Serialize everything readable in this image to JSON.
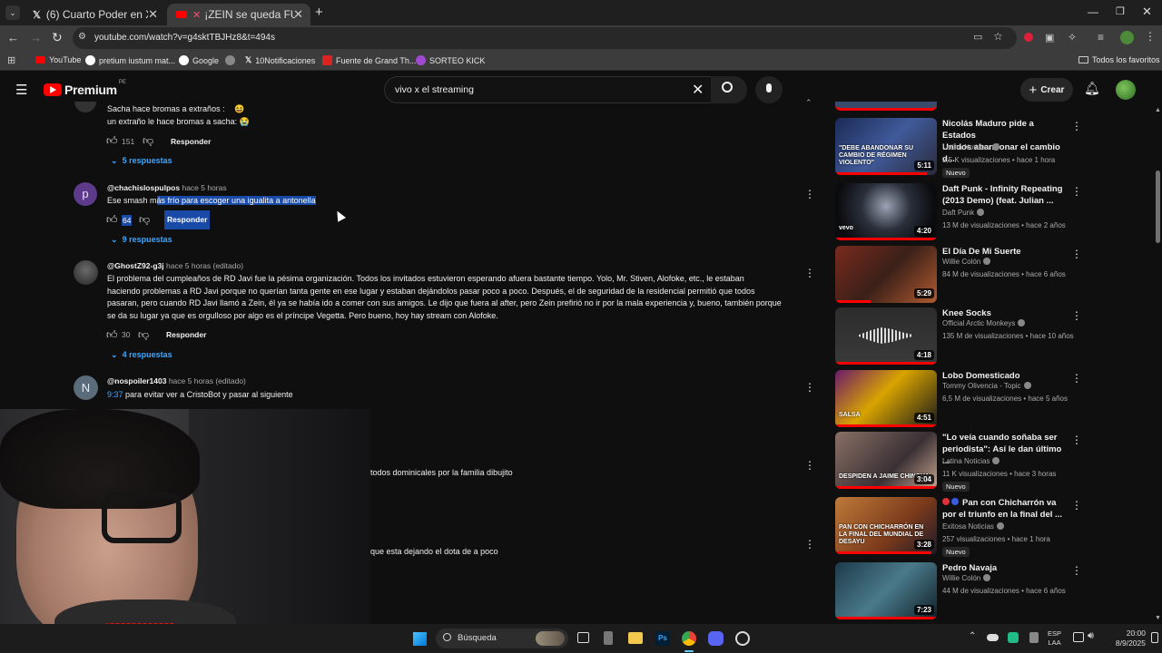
{
  "browser": {
    "tabs": [
      {
        "title": "(6) Cuarto Poder en X: \"#Cuarto"
      },
      {
        "title": "¡ZEIN se queda FUERA de FI"
      }
    ],
    "url": "youtube.com/watch?v=g4sktTBJHz8&t=494s",
    "bookmarks": [
      "YouTube",
      "pretium iustum mat...",
      "Google",
      "10Notificaciones",
      "Fuente de Grand Th...",
      "SORTEO KICK"
    ],
    "all_favorites": "Todos los favoritos"
  },
  "youtube": {
    "logo": "Premium",
    "region": "PE",
    "search_value": "vivo x el streaming",
    "create_label": "Crear"
  },
  "comments": [
    {
      "text_line1": "Sacha hace bromas a extraños :",
      "text_line2": "un extraño le hace bromas a sacha:",
      "likes": "151",
      "respond": "Responder",
      "replies": "5 respuestas"
    },
    {
      "avatar": "p",
      "author": "@chachislospulpos",
      "time": "hace 5 horas",
      "text_pre": "Ese smash m",
      "text_hl": "ás frío para escoger una igualita a antonella",
      "likes": "64",
      "respond": "Responder",
      "replies": "9 respuestas"
    },
    {
      "author": "@GhostZ92-g3j",
      "time": "hace 5 horas (editado)",
      "lines": [
        "El problema del cumpleaños de RD Javi fue la pésima organización. Todos los invitados estuvieron esperando afuera bastante tiempo. Yolo, Mr. Stiven, Alofoke, etc., le estaban",
        "haciendo problemas a RD Javi porque no querían tanta gente en ese lugar y estaban dejándolos pasar poco a poco. Después, el de seguridad de la residencial permitió que todos",
        "pasaran, pero cuando RD Javi llamó a Zein, él ya se había ido a comer con sus amigos. Le dijo que fuera al after, pero Zein prefirió no ir por la mala experiencia y, bueno, también porque",
        "se da su lugar ya que es orgulloso por algo es el príncipe Vegetta. Pero bueno, hoy hay stream con Alofoke."
      ],
      "likes": "30",
      "respond": "Responder",
      "replies": "4 respuestas"
    },
    {
      "avatar": "N",
      "author": "@nospoiler1403",
      "time": "hace 5 horas (editado)",
      "timestamp": "9:37",
      "text": "para evitar ver a CristoBot y pasar al siguiente"
    }
  ],
  "partial_comments": [
    "todos dominicales por la familia dibujito",
    "que esta dejando el dota de a poco"
  ],
  "sidebar": [
    {
      "title1": "Nicolás Maduro pide a Estados",
      "title2": "Unidos abandonar el cambio d...",
      "channel": "Latina Noticias",
      "meta": "2,5 K visualizaciones • hace 1 hora",
      "badge": "Nuevo",
      "duration": "5:11",
      "thumb_text": "\"DEBE ABANDONAR SU CAMBIO DE RÉGIMEN VIOLENTO\""
    },
    {
      "title1": "Daft Punk - Infinity Repeating",
      "title2": "(2013 Demo) (feat. Julian ...",
      "channel": "Daft Punk",
      "meta": "13 M de visualizaciones • hace 2 años",
      "duration": "4:20",
      "thumb_text": "vevo"
    },
    {
      "title1": "El Día De Mi Suerte",
      "channel": "Willie Colón",
      "meta": "84 M de visualizaciones • hace 6 años",
      "duration": "5:29"
    },
    {
      "title1": "Knee Socks",
      "channel": "Official Arctic Monkeys",
      "meta": "135 M de visualizaciones • hace 10 años",
      "duration": "4:18"
    },
    {
      "title1": "Lobo Domesticado",
      "channel": "Tommy Olivencia - Topic",
      "meta": "6,5 M de visualizaciones • hace 5 años",
      "duration": "4:51",
      "thumb_text": "SALSA"
    },
    {
      "title1": "\"Lo veía cuando soñaba ser",
      "title2": "periodista\": Así le dan último ...",
      "channel": "Latina Noticias",
      "meta": "11 K visualizaciones • hace 3 horas",
      "badge": "Nuevo",
      "duration": "3:04",
      "thumb_text": "DESPIDEN A JAIME CHINCHA"
    },
    {
      "title1": "Pan con Chicharrón va",
      "title2": "por el triunfo en la final del ...",
      "channel": "Exitosa Noticias",
      "meta": "257 visualizaciones • hace 1 hora",
      "badge": "Nuevo",
      "duration": "3:28",
      "thumb_text": "PAN CON CHICHARRÓN EN LA FINAL DEL MUNDIAL DE DESAYU"
    },
    {
      "title1": "Pedro Navaja",
      "channel": "Willie Colón",
      "meta": "44 M de visualizaciones • hace 6 años",
      "duration": "7:23"
    }
  ],
  "taskbar": {
    "search": "Búsqueda",
    "lang1": "ESP",
    "lang2": "LAA",
    "time": "20:00",
    "date": "8/9/2025"
  },
  "colors": {
    "accent": "#3ea6ff",
    "highlight": "#1a4aa8",
    "youtube_red": "#ff0000"
  }
}
